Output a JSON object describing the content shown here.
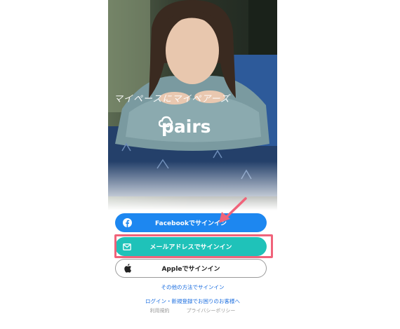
{
  "hero": {
    "tagline": "マイペースにマイペアーズ",
    "brand_name": "pairs"
  },
  "buttons": {
    "facebook_label": "Facebookでサインイン",
    "mail_label": "メールアドレスでサインイン",
    "apple_label": "Appleでサインイン"
  },
  "links": {
    "other_methods": "その他の方法でサインイン",
    "login_help": "ログイン・新規登録でお困りのお客様へ"
  },
  "footer": {
    "terms": "利用規約",
    "privacy": "プライバシーポリシー"
  },
  "colors": {
    "facebook": "#1d87f0",
    "mail": "#1fc2b9",
    "highlight": "#f0637a",
    "link": "#1d6fe0"
  },
  "icons": {
    "facebook": "facebook-icon",
    "mail": "mail-icon",
    "apple": "apple-icon",
    "logo": "cloud-icon",
    "annotation": "arrow-icon"
  }
}
